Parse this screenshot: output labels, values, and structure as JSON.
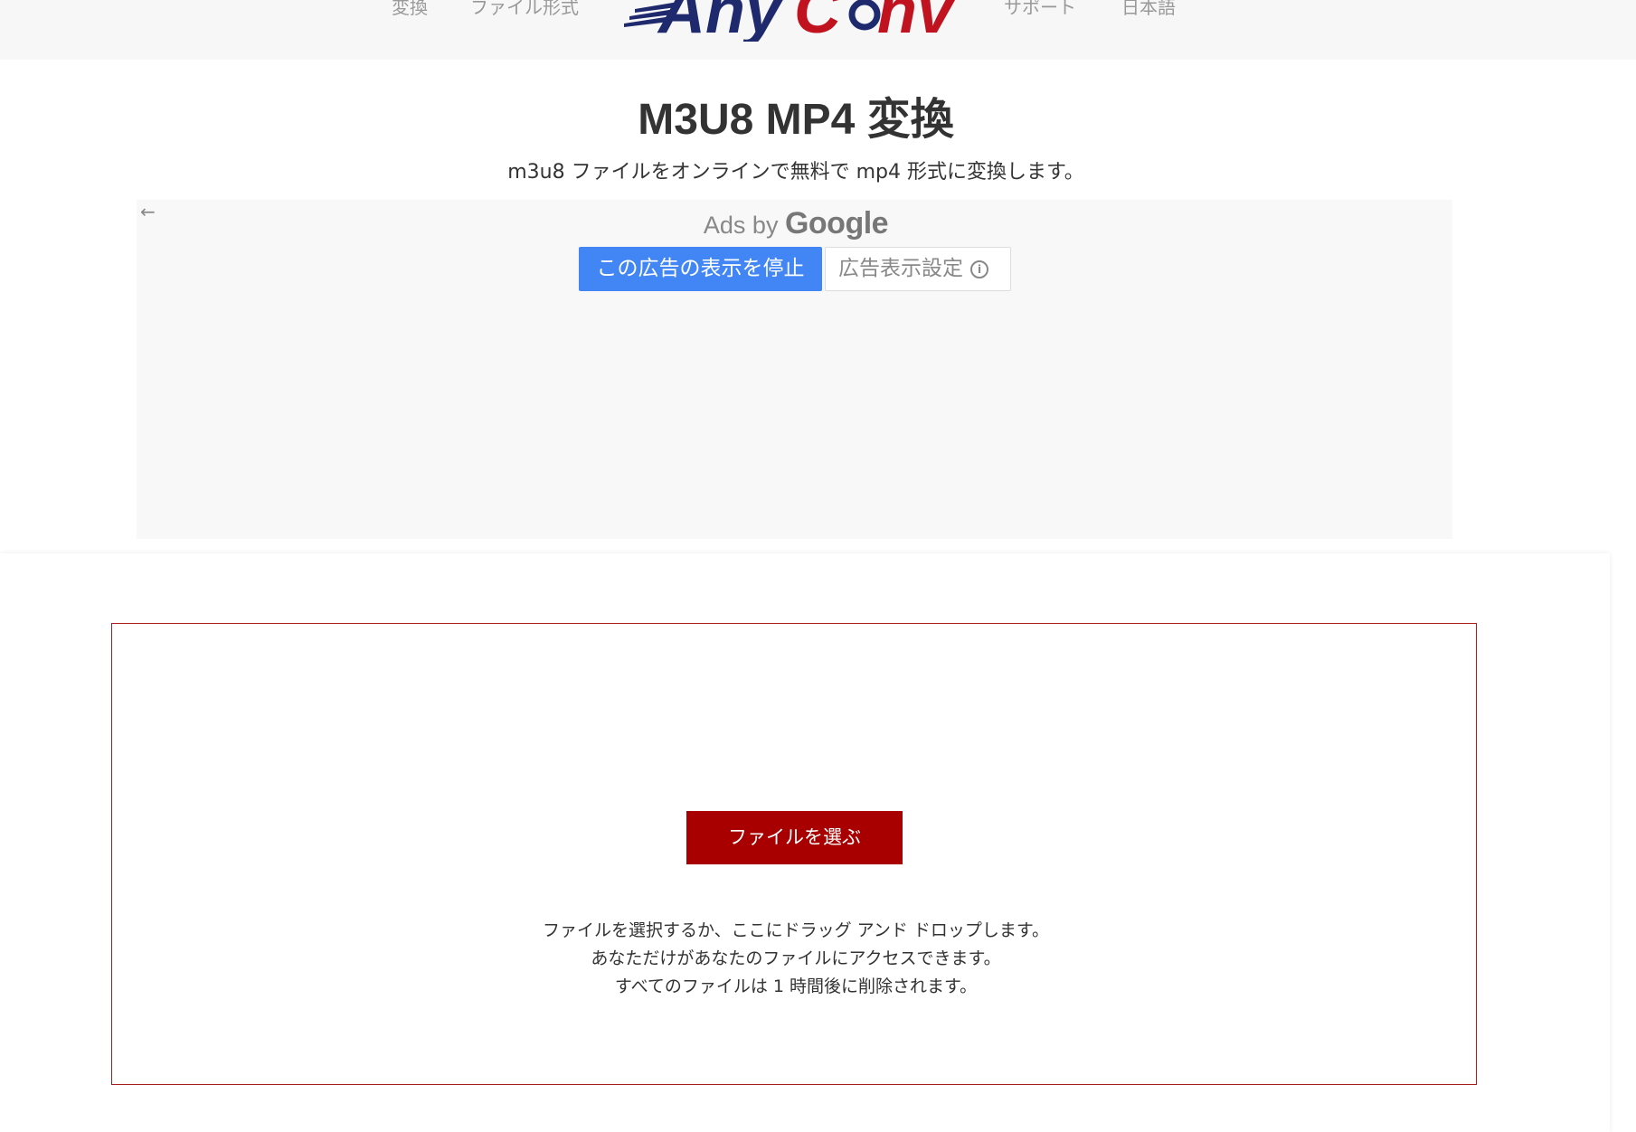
{
  "nav": {
    "items_left": [
      "変換",
      "ファイル形式"
    ],
    "items_right": [
      "サポート",
      "日本語"
    ],
    "logo_text": "AnyConv",
    "logo_colors": {
      "any": "#1f2a6e",
      "conv": "#c1121f"
    }
  },
  "main": {
    "title": "M3U8 MP4 変換",
    "subtitle": "m3u8 ファイルをオンラインで無料で mp4 形式に変換します。"
  },
  "ad": {
    "back_icon": "arrow-left-icon",
    "ads_by": "Ads by",
    "google": "Google",
    "stop_button": "この広告の表示を停止",
    "settings_button": "広告表示設定",
    "info_icon": "info-icon",
    "stop_color": "#4285f4"
  },
  "upload": {
    "choose_button": "ファイルを選ぶ",
    "info_lines": [
      "ファイルを選択するか、ここにドラッグ アンド ドロップします。",
      "あなただけがあなたのファイルにアクセスできます。",
      "すべてのファイルは 1 時間後に削除されます。"
    ],
    "accent_color": "#a80000"
  }
}
